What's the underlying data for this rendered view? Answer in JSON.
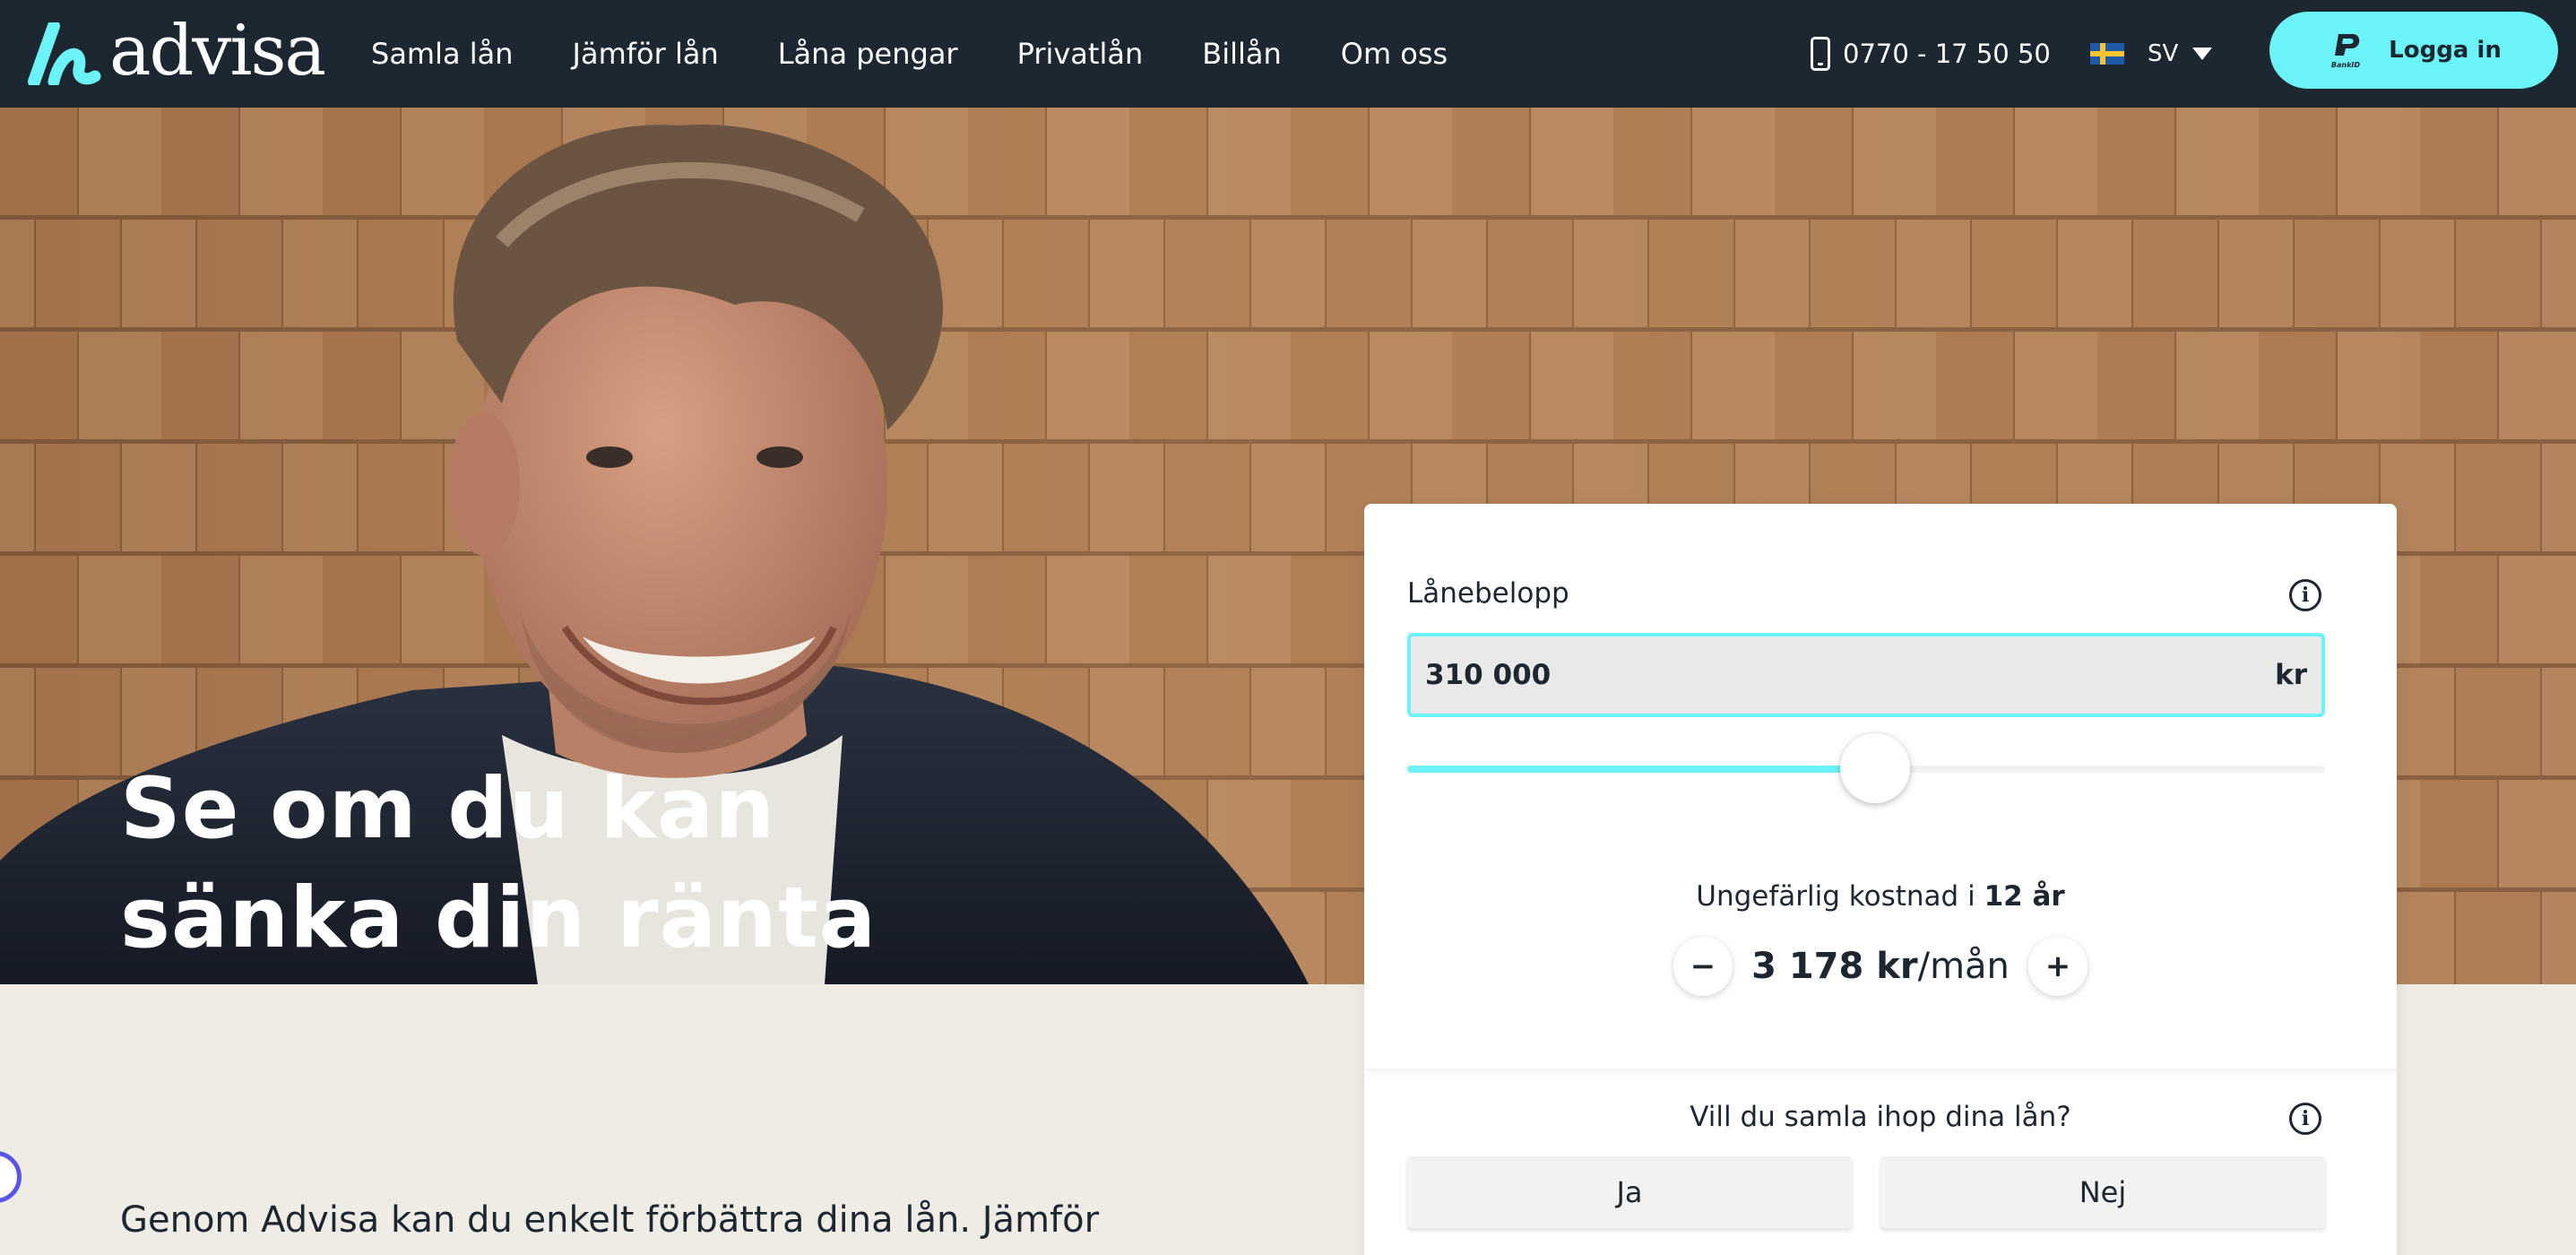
{
  "header": {
    "logo_text": "advisa",
    "nav_items": [
      {
        "label": "Samla lån"
      },
      {
        "label": "Jämför lån"
      },
      {
        "label": "Låna pengar"
      },
      {
        "label": "Privatlån"
      },
      {
        "label": "Billån"
      },
      {
        "label": "Om oss"
      }
    ],
    "phone": "0770 - 17 50 50",
    "language": "SV",
    "login_label": "Logga in",
    "bankid_text": "BankID"
  },
  "hero": {
    "title_line1": "Se om du kan",
    "title_line2": "sänka din ränta"
  },
  "calculator": {
    "amount_label": "Lånebelopp",
    "amount_value": "310 000",
    "amount_unit": "kr",
    "slider_fraction": 0.51,
    "cost_label_prefix": "Ungefärlig kostnad i",
    "cost_label_years": "12 år",
    "monthly_cost": "3 178 kr",
    "monthly_suffix": "/mån",
    "decrease_label": "−",
    "increase_label": "+",
    "info_glyph": "i",
    "consolidate_question": "Vill du samla ihop dina lån?",
    "yes_label": "Ja",
    "no_label": "Nej"
  },
  "intro": {
    "text": "Genom Advisa kan du enkelt förbättra dina lån. Jämför"
  },
  "colors": {
    "nav_bg": "#1d2731",
    "accent": "#6cf3f7",
    "page_bg": "#efebe5"
  },
  "icons": {
    "phone": "phone-icon",
    "flag": "sweden-flag-icon",
    "caret": "caret-down-icon",
    "bankid": "bankid-icon",
    "info": "info-icon"
  }
}
